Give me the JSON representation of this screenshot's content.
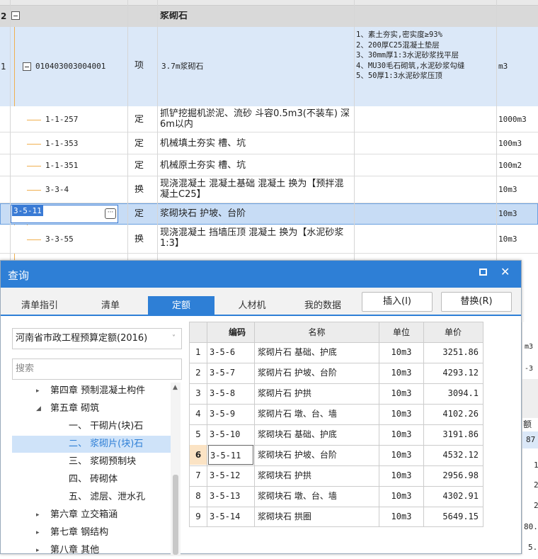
{
  "grid": {
    "group_row": {
      "num": "2",
      "name": "浆砌石"
    },
    "item_row": {
      "num": "1",
      "code": "010403003004001",
      "type": "项",
      "name": "3.7m浆砌石",
      "features": "1、素土夯实,密实度≥93%\n2、200厚C25混凝土垫层\n3、30mm厚1:3水泥砂浆找平层\n4、MU30毛石砌筑,水泥砂浆勾缝\n5、50厚1:3水泥砂浆压顶",
      "unit": "m3"
    },
    "rows": [
      {
        "code": "1-1-257",
        "type": "定",
        "name": "抓铲挖掘机淤泥、流砂 斗容0.5m3(不装车) 深6m以内",
        "unit": "1000m3"
      },
      {
        "code": "1-1-353",
        "type": "定",
        "name": "机械填土夯实 槽、坑",
        "unit": "100m3"
      },
      {
        "code": "1-1-351",
        "type": "定",
        "name": "机械原土夯实 槽、坑",
        "unit": "100m2"
      },
      {
        "code": "3-3-4",
        "type": "换",
        "name": "现浇混凝土 混凝土基础 混凝土  换为【预拌混凝土C25】",
        "unit": "10m3"
      },
      {
        "code": "3-5-11",
        "type": "定",
        "name": "浆砌块石 护坡、台阶",
        "unit": "10m3"
      },
      {
        "code": "3-3-55",
        "type": "换",
        "name": "现浇混凝土 挡墙压顶 混凝土  换为【水泥砂浆 1:3】",
        "unit": "10m3"
      }
    ],
    "ellipsis": "···"
  },
  "dialog": {
    "title": "查询",
    "maximize": "□",
    "close": "✕",
    "tabs": [
      "清单指引",
      "清单",
      "定额",
      "人材机",
      "我的数据"
    ],
    "active_tab": 2,
    "insert_btn": "插入(I)",
    "replace_btn": "替换(R)",
    "quota_select": "河南省市政工程预算定额(2016)",
    "search_placeholder": "搜索",
    "tree": [
      {
        "label": "第四章 预制混凝土构件",
        "indent": 0,
        "arrow": "▸"
      },
      {
        "label": "第五章 砌筑",
        "indent": 0,
        "arrow": "◢"
      },
      {
        "label": "一、 干砌片(块)石",
        "indent": 1,
        "arrow": ""
      },
      {
        "label": "二、 浆砌片(块)石",
        "indent": 1,
        "arrow": "",
        "selected": true
      },
      {
        "label": "三、 浆砌预制块",
        "indent": 1,
        "arrow": ""
      },
      {
        "label": "四、 砖砌体",
        "indent": 1,
        "arrow": ""
      },
      {
        "label": "五、 滤层、泄水孔",
        "indent": 1,
        "arrow": ""
      },
      {
        "label": "第六章 立交箱涵",
        "indent": 0,
        "arrow": "▸"
      },
      {
        "label": "第七章 钢结构",
        "indent": 0,
        "arrow": "▸"
      },
      {
        "label": "第八章 其他",
        "indent": 0,
        "arrow": "▸"
      }
    ],
    "table": {
      "headers": [
        "编码",
        "名称",
        "单位",
        "单价"
      ],
      "rows": [
        {
          "n": "1",
          "code": "3-5-6",
          "name": "浆砌片石 基础、护底",
          "unit": "10m3",
          "price": "3251.86"
        },
        {
          "n": "2",
          "code": "3-5-7",
          "name": "浆砌片石 护坡、台阶",
          "unit": "10m3",
          "price": "4293.12"
        },
        {
          "n": "3",
          "code": "3-5-8",
          "name": "浆砌片石 护拱",
          "unit": "10m3",
          "price": "3094.1"
        },
        {
          "n": "4",
          "code": "3-5-9",
          "name": "浆砌片石 墩、台、墙",
          "unit": "10m3",
          "price": "4102.26"
        },
        {
          "n": "5",
          "code": "3-5-10",
          "name": "浆砌块石 基础、护底",
          "unit": "10m3",
          "price": "3191.86"
        },
        {
          "n": "6",
          "code": "3-5-11",
          "name": "浆砌块石 护坡、台阶",
          "unit": "10m3",
          "price": "4532.12"
        },
        {
          "n": "7",
          "code": "3-5-12",
          "name": "浆砌块石 护拱",
          "unit": "10m3",
          "price": "2956.98"
        },
        {
          "n": "8",
          "code": "3-5-13",
          "name": "浆砌块石 墩、台、墙",
          "unit": "10m3",
          "price": "4302.91"
        },
        {
          "n": "9",
          "code": "3-5-14",
          "name": "浆砌块石 拱圈",
          "unit": "10m3",
          "price": "5649.15"
        }
      ]
    }
  },
  "right_peek": [
    "m3",
    "-3",
    "额价",
    "87",
    "1",
    "2",
    "2",
    "80.",
    "5."
  ]
}
